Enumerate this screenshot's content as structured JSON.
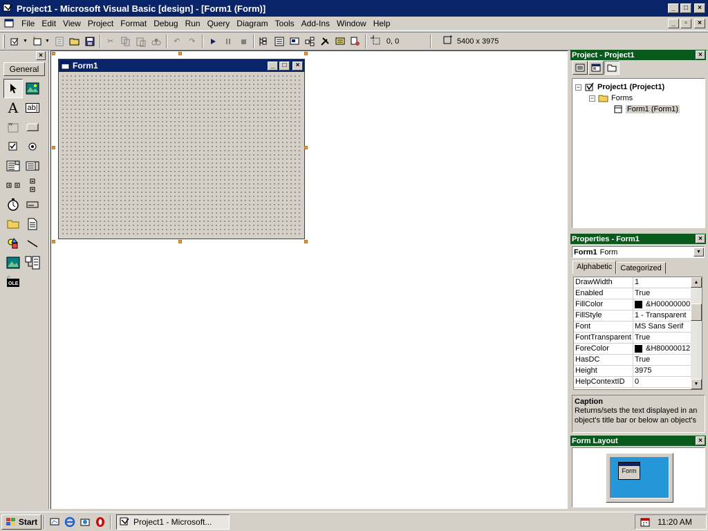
{
  "window": {
    "title": "Project1 - Microsoft Visual Basic [design] - [Form1 (Form)]",
    "caption_buttons": [
      "minimize",
      "maximize",
      "close"
    ]
  },
  "menu": {
    "items": [
      "File",
      "Edit",
      "View",
      "Project",
      "Format",
      "Debug",
      "Run",
      "Query",
      "Diagram",
      "Tools",
      "Add-Ins",
      "Window",
      "Help"
    ]
  },
  "toolbar": {
    "position_readout": "0, 0",
    "size_readout": "5400 x 3975"
  },
  "toolbox": {
    "tab_label": "General",
    "tools": [
      "pointer",
      "picturebox",
      "label",
      "textbox",
      "frame",
      "commandbutton",
      "checkbox",
      "optionbutton",
      "combobox",
      "listbox",
      "hscrollbar",
      "vscrollbar",
      "timer",
      "drivelistbox",
      "dirlistbox",
      "filelistbox",
      "shape",
      "line",
      "image",
      "data",
      "ole"
    ]
  },
  "form": {
    "caption": "Form1"
  },
  "project_panel": {
    "title": "Project - Project1",
    "tree": {
      "project": "Project1 (Project1)",
      "folder": "Forms",
      "form": "Form1 (Form1)"
    }
  },
  "properties_panel": {
    "title": "Properties - Form1",
    "object_name": "Form1",
    "object_type": "Form",
    "tabs": [
      "Alphabetic",
      "Categorized"
    ],
    "active_tab": "Alphabetic",
    "rows": [
      {
        "name": "DrawWidth",
        "value": "1",
        "swatch": false
      },
      {
        "name": "Enabled",
        "value": "True",
        "swatch": false
      },
      {
        "name": "FillColor",
        "value": "&H00000000",
        "swatch": true
      },
      {
        "name": "FillStyle",
        "value": "1 - Transparent",
        "swatch": false
      },
      {
        "name": "Font",
        "value": "MS Sans Serif",
        "swatch": false
      },
      {
        "name": "FontTransparent",
        "value": "True",
        "swatch": false
      },
      {
        "name": "ForeColor",
        "value": "&H80000012",
        "swatch": true
      },
      {
        "name": "HasDC",
        "value": "True",
        "swatch": false
      },
      {
        "name": "Height",
        "value": "3975",
        "swatch": false
      },
      {
        "name": "HelpContextID",
        "value": "0",
        "swatch": false
      }
    ],
    "description_title": "Caption",
    "description_text": "Returns/sets the text displayed in an object's title bar or below an object's"
  },
  "layout_panel": {
    "title": "Form Layout",
    "form_label": "Form"
  },
  "taskbar": {
    "start_label": "Start",
    "task_label": "Project1 - Microsoft...",
    "clock": "11:20 AM"
  },
  "colors": {
    "active_title": "#0a246a",
    "panel_title": "#0a5a1e",
    "face": "#d4d0c8",
    "desktop_preview": "#2596d8"
  }
}
